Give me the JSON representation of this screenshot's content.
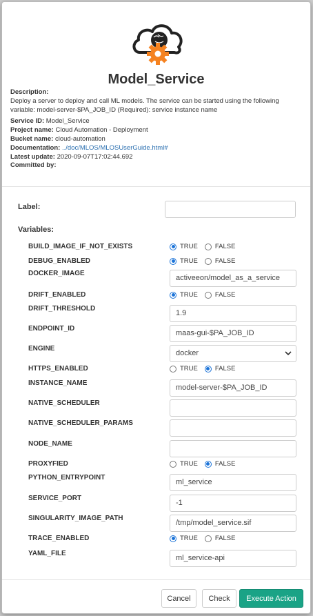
{
  "title": "Model_Service",
  "info": {
    "description_label": "Description:",
    "description_text": "Deploy a server to deploy and call ML models. The service can be started using the following variable: model-server-$PA_JOB_ID (Required): service instance name",
    "service_id_label": "Service ID:",
    "service_id": "Model_Service",
    "project_label": "Project name:",
    "project": "Cloud Automation - Deployment",
    "bucket_label": "Bucket name:",
    "bucket": "cloud-automation",
    "doc_label": "Documentation:",
    "doc_link": "../doc/MLOS/MLOSUserGuide.html#",
    "update_label": "Latest update:",
    "update": "2020-09-07T17:02:44.692",
    "committed_label": "Committed by:",
    "committed": ""
  },
  "form": {
    "label_text": "Label:",
    "label_value": "",
    "variables_text": "Variables:"
  },
  "variables": [
    {
      "name": "BUILD_IMAGE_IF_NOT_EXISTS",
      "type": "bool",
      "value": "TRUE"
    },
    {
      "name": "DEBUG_ENABLED",
      "type": "bool",
      "value": "TRUE"
    },
    {
      "name": "DOCKER_IMAGE",
      "type": "text",
      "value": "activeeon/model_as_a_service"
    },
    {
      "name": "DRIFT_ENABLED",
      "type": "bool",
      "value": "TRUE"
    },
    {
      "name": "DRIFT_THRESHOLD",
      "type": "text",
      "value": "1.9"
    },
    {
      "name": "ENDPOINT_ID",
      "type": "text",
      "value": "maas-gui-$PA_JOB_ID"
    },
    {
      "name": "ENGINE",
      "type": "select",
      "value": "docker"
    },
    {
      "name": "HTTPS_ENABLED",
      "type": "bool",
      "value": "FALSE"
    },
    {
      "name": "INSTANCE_NAME",
      "type": "text",
      "value": "model-server-$PA_JOB_ID"
    },
    {
      "name": "NATIVE_SCHEDULER",
      "type": "text",
      "value": ""
    },
    {
      "name": "NATIVE_SCHEDULER_PARAMS",
      "type": "text",
      "value": ""
    },
    {
      "name": "NODE_NAME",
      "type": "text",
      "value": ""
    },
    {
      "name": "PROXYFIED",
      "type": "bool",
      "value": "FALSE"
    },
    {
      "name": "PYTHON_ENTRYPOINT",
      "type": "text",
      "value": "ml_service"
    },
    {
      "name": "SERVICE_PORT",
      "type": "text",
      "value": "-1"
    },
    {
      "name": "SINGULARITY_IMAGE_PATH",
      "type": "text",
      "value": "/tmp/model_service.sif"
    },
    {
      "name": "TRACE_ENABLED",
      "type": "bool",
      "value": "TRUE"
    },
    {
      "name": "YAML_FILE",
      "type": "text",
      "value": "ml_service-api"
    }
  ],
  "bool_labels": {
    "true": "TRUE",
    "false": "FALSE"
  },
  "buttons": {
    "cancel": "Cancel",
    "check": "Check",
    "execute": "Execute Action"
  },
  "colors": {
    "accent": "#1aa386",
    "radio": "#1b73d8",
    "gear": "#f58220",
    "link": "#2a6fb0"
  },
  "icons": {
    "logo": "cloud-brain-gear-icon",
    "select": "chevron-down-icon"
  }
}
